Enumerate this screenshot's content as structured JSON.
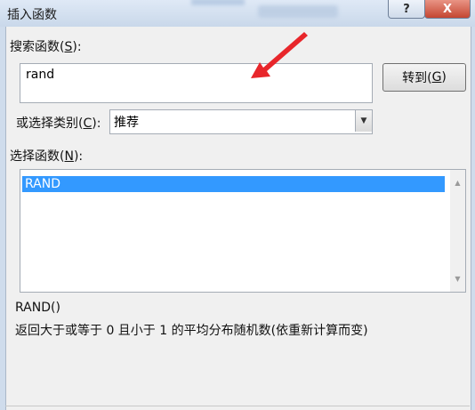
{
  "window": {
    "title": "插入函数",
    "help_label": "?",
    "close_label": "X"
  },
  "search": {
    "label_prefix": "搜索函数(",
    "label_key": "S",
    "label_suffix": "):",
    "value": "rand",
    "goto_prefix": "转到(",
    "goto_key": "G",
    "goto_suffix": ")"
  },
  "category": {
    "label_prefix": "或选择类别(",
    "label_key": "C",
    "label_suffix": "):",
    "selected": "推荐"
  },
  "functions": {
    "label_prefix": "选择函数(",
    "label_key": "N",
    "label_suffix": "):",
    "items": [
      "RAND"
    ],
    "selected_index": 0
  },
  "description": {
    "signature": "RAND()",
    "text": "返回大于或等于 0 且小于 1 的平均分布随机数(依重新计算而变)"
  },
  "colors": {
    "selection": "#3399ff",
    "annotation_arrow": "#e8262b"
  }
}
